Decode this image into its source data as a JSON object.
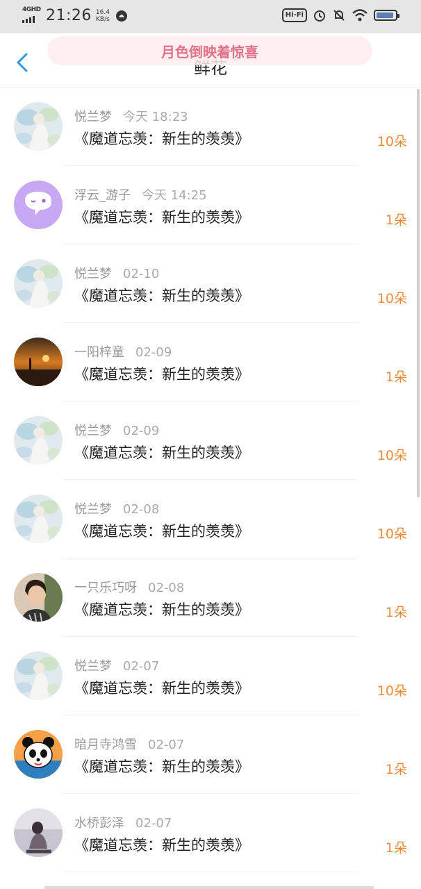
{
  "status_bar": {
    "network": "4GHD",
    "time": "21:26",
    "speed_value": "16.4",
    "speed_unit": "KB/s",
    "hifi": "Hi-Fi"
  },
  "header": {
    "title": "鲜花",
    "toast": "月色倒映着惊喜",
    "back_icon": "chevron-left-icon"
  },
  "colors": {
    "count": "#ee8a3a",
    "back": "#2d9ae8",
    "toast": "#e0738a"
  },
  "items": [
    {
      "user": "悦兰梦",
      "time": "今天 18:23",
      "book": "《魔道忘羡：新生的羡羡》",
      "count": "10朵",
      "avatar": "flower-art"
    },
    {
      "user": "浮云_游子",
      "time": "今天 14:25",
      "book": "《魔道忘羡：新生的羡羡》",
      "count": "1朵",
      "avatar": "chat-bubble"
    },
    {
      "user": "悦兰梦",
      "time": "02-10",
      "book": "《魔道忘羡：新生的羡羡》",
      "count": "10朵",
      "avatar": "flower-art"
    },
    {
      "user": "一阳梓童",
      "time": "02-09",
      "book": "《魔道忘羡：新生的羡羡》",
      "count": "1朵",
      "avatar": "sunset"
    },
    {
      "user": "悦兰梦",
      "time": "02-09",
      "book": "《魔道忘羡：新生的羡羡》",
      "count": "10朵",
      "avatar": "flower-art"
    },
    {
      "user": "悦兰梦",
      "time": "02-08",
      "book": "《魔道忘羡：新生的羡羡》",
      "count": "10朵",
      "avatar": "flower-art"
    },
    {
      "user": "一只乐巧呀",
      "time": "02-08",
      "book": "《魔道忘羡：新生的羡羡》",
      "count": "1朵",
      "avatar": "portrait"
    },
    {
      "user": "悦兰梦",
      "time": "02-07",
      "book": "《魔道忘羡：新生的羡羡》",
      "count": "10朵",
      "avatar": "flower-art"
    },
    {
      "user": "暗月寺鸿雪",
      "time": "02-07",
      "book": "《魔道忘羡：新生的羡羡》",
      "count": "1朵",
      "avatar": "panda"
    },
    {
      "user": "水桥彭泽",
      "time": "02-07",
      "book": "《魔道忘羡：新生的羡羡》",
      "count": "1朵",
      "avatar": "sitting-girl"
    }
  ]
}
